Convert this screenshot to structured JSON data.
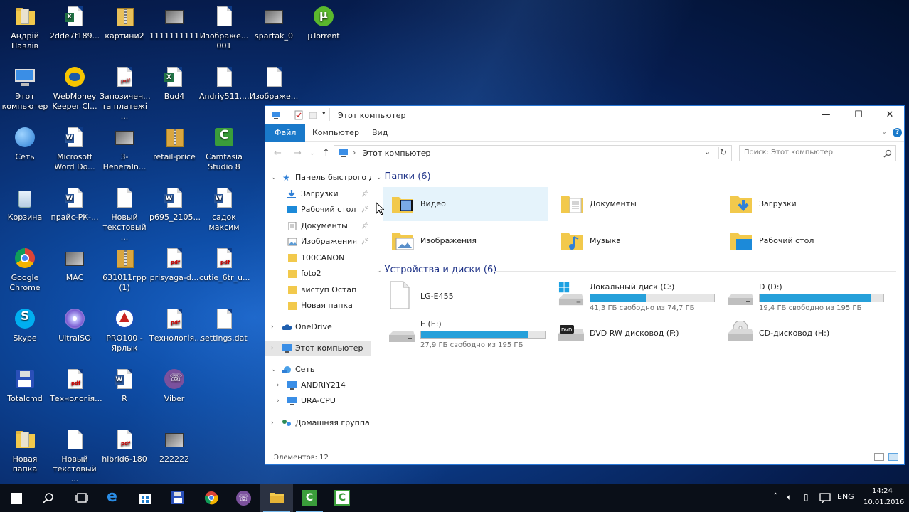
{
  "desktop": {
    "icons": [
      {
        "label": "Андрій Павлів",
        "icon": "folder-zip-icon"
      },
      {
        "label": "2dde7f189...",
        "icon": "excel-icon"
      },
      {
        "label": "картини2",
        "icon": "zip-icon"
      },
      {
        "label": "1111111111",
        "icon": "image-icon"
      },
      {
        "label": "Изображе... 001",
        "icon": "document-icon"
      },
      {
        "label": "spartak_0",
        "icon": "image-icon"
      },
      {
        "label": "µTorrent",
        "icon": "utorrent-icon"
      },
      {
        "label": "Этот компьютер",
        "icon": "computer-icon"
      },
      {
        "label": "WebMoney Keeper Cl...",
        "icon": "webmoney-icon"
      },
      {
        "label": "Запозичен... та платежі ...",
        "icon": "pdf-icon"
      },
      {
        "label": "Bud4",
        "icon": "excel-icon"
      },
      {
        "label": "Andriy511....",
        "icon": "document-icon"
      },
      {
        "label": "Изображе...",
        "icon": "document-icon"
      },
      {
        "label": "Сеть",
        "icon": "network-icon"
      },
      {
        "label": "Microsoft Word Do...",
        "icon": "word-icon"
      },
      {
        "label": "3-HeneraIn...",
        "icon": "image-icon"
      },
      {
        "label": "retail-price",
        "icon": "rar-icon"
      },
      {
        "label": "Camtasia Studio 8",
        "icon": "camtasia-icon"
      },
      {
        "label": "Корзина",
        "icon": "recycle-bin-icon"
      },
      {
        "label": "прайс-РК-...",
        "icon": "word-icon"
      },
      {
        "label": "Новый текстовый ...",
        "icon": "document-icon"
      },
      {
        "label": "p695_2105...",
        "icon": "word-icon"
      },
      {
        "label": "садок максим",
        "icon": "word-icon"
      },
      {
        "label": "Google Chrome",
        "icon": "chrome-icon"
      },
      {
        "label": "MAC",
        "icon": "image-icon"
      },
      {
        "label": "631011грр (1)",
        "icon": "rar-icon"
      },
      {
        "label": "prisyaga-d...",
        "icon": "pdf-icon"
      },
      {
        "label": "cutie_6tr_u...",
        "icon": "pdf-icon"
      },
      {
        "label": "Skype",
        "icon": "skype-icon"
      },
      {
        "label": "UltraISO",
        "icon": "ultraiso-icon"
      },
      {
        "label": "PRO100 - Ярлык",
        "icon": "pro100-icon"
      },
      {
        "label": "Технологія...",
        "icon": "pdf-icon"
      },
      {
        "label": "settings.dat",
        "icon": "document-icon"
      },
      {
        "label": "Totalcmd",
        "icon": "totalcmd-icon"
      },
      {
        "label": "Технологія...",
        "icon": "pdf-icon"
      },
      {
        "label": "R",
        "icon": "word-icon"
      },
      {
        "label": "Viber",
        "icon": "viber-icon"
      },
      {
        "label": "Новая папка",
        "icon": "folder-zip-icon"
      },
      {
        "label": "Новый текстовый ...",
        "icon": "document-icon"
      },
      {
        "label": "hibrid6-180",
        "icon": "pdf-icon"
      },
      {
        "label": "222222",
        "icon": "image-icon"
      }
    ]
  },
  "window": {
    "title": "Этот компьютер",
    "tabs": [
      "Файл",
      "Компьютер",
      "Вид"
    ],
    "address": "Этот компьютер",
    "search_placeholder": "Поиск: Этот компьютер",
    "status": "Элементов: 12"
  },
  "nav": {
    "quick_access": "Панель быстрого дс",
    "pinned": [
      "Загрузки",
      "Рабочий стол",
      "Документы",
      "Изображения"
    ],
    "folders": [
      "100CANON",
      "foto2",
      "виступ Остап",
      "Новая папка"
    ],
    "onedrive": "OneDrive",
    "this_pc": "Этот компьютер",
    "network": "Сеть",
    "network_items": [
      "ANDRIY214",
      "URA-CPU"
    ],
    "homegroup": "Домашняя группа"
  },
  "content": {
    "folders_header": "Папки (6)",
    "folders": [
      "Видео",
      "Документы",
      "Загрузки",
      "Изображения",
      "Музыка",
      "Рабочий стол"
    ],
    "devices_header": "Устройства и диски (6)",
    "devices": [
      {
        "name": "LG-E455",
        "free": "",
        "used_fraction": null
      },
      {
        "name": "Локальный диск (C:)",
        "free": "41,3 ГБ свободно из 74,7 ГБ",
        "used_fraction": 0.45
      },
      {
        "name": "D (D:)",
        "free": "19,4 ГБ свободно из 195 ГБ",
        "used_fraction": 0.9
      },
      {
        "name": "E (E:)",
        "free": "27,9 ГБ свободно из 195 ГБ",
        "used_fraction": 0.86
      },
      {
        "name": "DVD RW дисковод (F:)",
        "free": "",
        "used_fraction": null
      },
      {
        "name": "CD-дисковод (H:)",
        "free": "",
        "used_fraction": null
      }
    ]
  },
  "taskbar": {
    "lang": "ENG",
    "time": "14:24",
    "date": "10.01.2016"
  },
  "colors": {
    "accent": "#1979ca",
    "bar_fill": "#26a0da",
    "header": "#1e3287"
  }
}
